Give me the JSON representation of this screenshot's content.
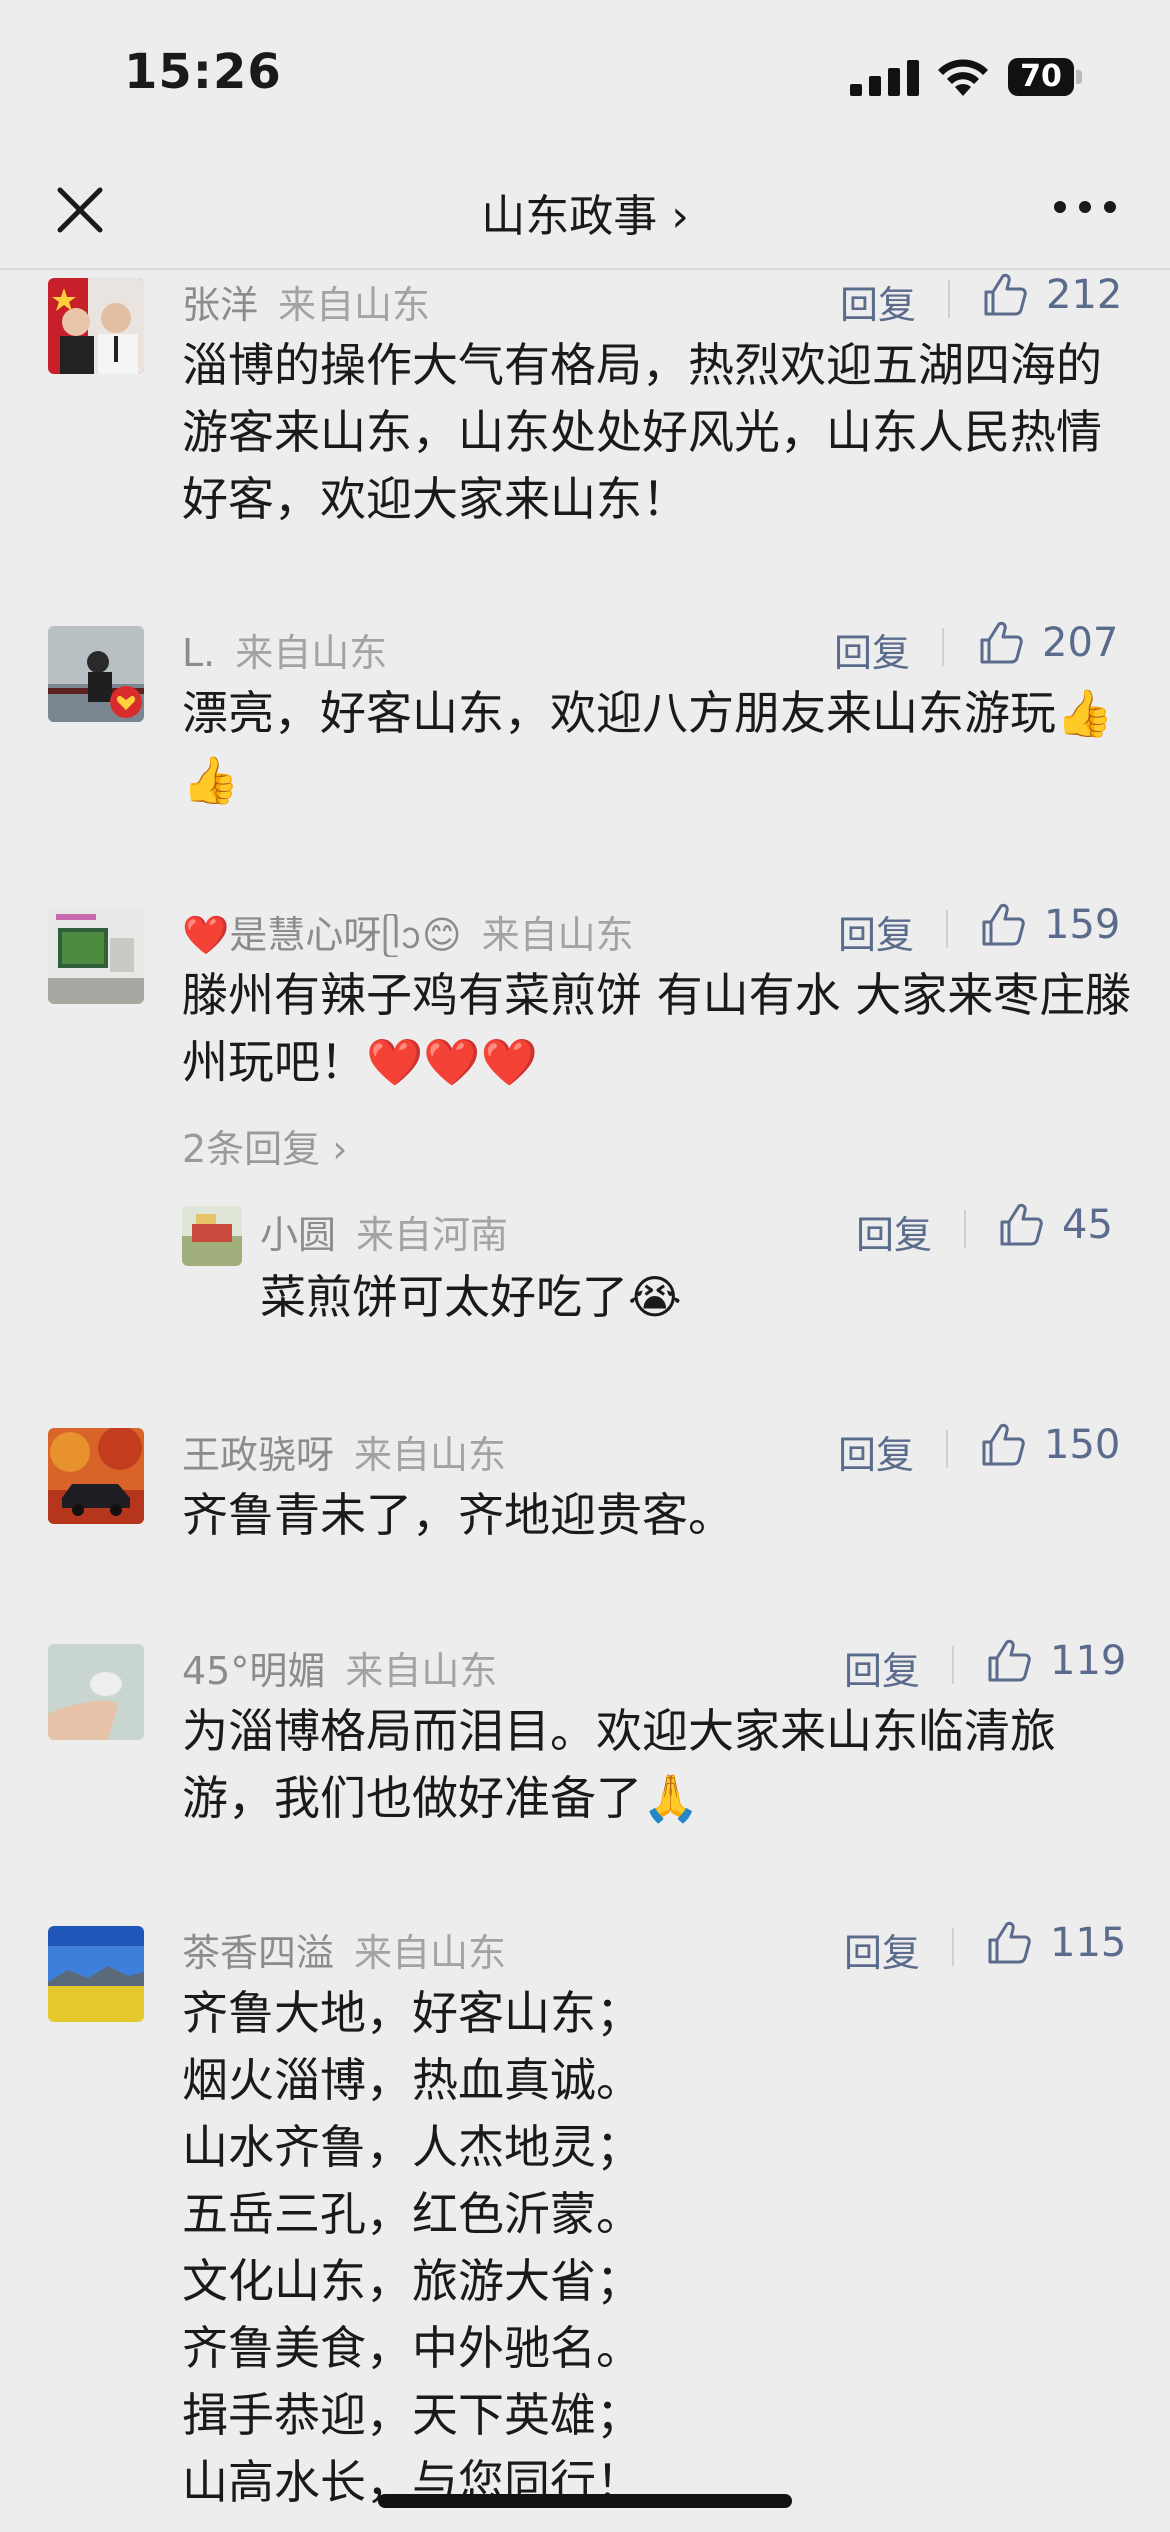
{
  "status_bar": {
    "time": "15:26",
    "battery": "70"
  },
  "nav": {
    "title": "山东政事 ›"
  },
  "comments": [
    {
      "name": "张洋",
      "region": "来自山东",
      "reply": "回复",
      "likes": "212",
      "text": "淄博的操作大气有格局，热烈欢迎五湖四海的游客来山东，山东处处好风光，山东人民热情好客，欢迎大家来山东！"
    },
    {
      "name": "L.",
      "region": "来自山东",
      "reply": "回复",
      "likes": "207",
      "text": "漂亮，好客山东，欢迎八方朋友来山东游玩👍👍"
    },
    {
      "name": "❤️是慧心呀ᥫᩣ😊",
      "region": "来自山东",
      "reply": "回复",
      "likes": "159",
      "text": "滕州有辣子鸡有菜煎饼 有山有水 大家来枣庄滕州玩吧！❤️❤️❤️",
      "replies_link": "2条回复 ›",
      "sub_reply": {
        "name": "小圆",
        "region": "来自河南",
        "reply": "回复",
        "likes": "45",
        "text": "菜煎饼可太好吃了😭"
      }
    },
    {
      "name": "王政骁呀",
      "region": "来自山东",
      "reply": "回复",
      "likes": "150",
      "text": "齐鲁青未了，齐地迎贵客。"
    },
    {
      "name": "45°明媚",
      "region": "来自山东",
      "reply": "回复",
      "likes": "119",
      "text": "为淄博格局而泪目。欢迎大家来山东临清旅游，我们也做好准备了🙏"
    },
    {
      "name": "茶香四溢",
      "region": "来自山东",
      "reply": "回复",
      "likes": "115",
      "poem": [
        "齐鲁大地，好客山东；",
        "烟火淄博，热血真诚。",
        "山水齐鲁，人杰地灵；",
        "五岳三孔，红色沂蒙。",
        "文化山东，旅游大省；",
        "齐鲁美食，中外驰名。",
        "揖手恭迎，天下英雄；",
        "山高水长，与您同行！"
      ]
    }
  ],
  "colors": {
    "background": "#ededed",
    "link": "#5a6b8c",
    "meta": "#8c8c8c"
  },
  "icons": {
    "close": "close-icon",
    "more": "more-icon",
    "like": "thumbs-up-icon"
  }
}
